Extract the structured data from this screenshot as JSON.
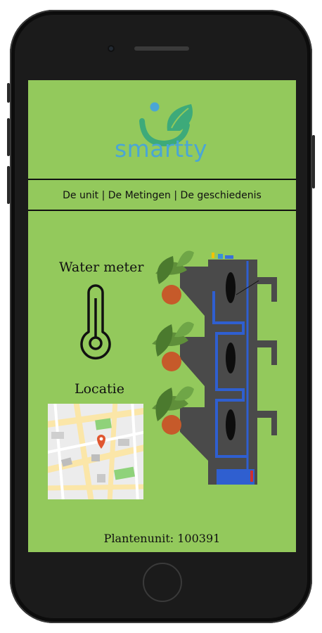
{
  "brand": {
    "name": "smartty",
    "color": "#4aa6d5",
    "leaf_color": "#3daa7a"
  },
  "nav": {
    "unit": "De unit",
    "separator": " | ",
    "measurements": "De Metingen",
    "history": "De geschiedenis"
  },
  "water_meter": {
    "title": "Water meter",
    "icon": "thermometer-icon"
  },
  "location": {
    "title": "Locatie",
    "icon": "map-pin-icon"
  },
  "plant_unit": {
    "label": "Plantenunit:",
    "value": "100391"
  },
  "colors": {
    "screen_background": "#93c95c",
    "tower": "#4a4a4a",
    "pipes": "#2f5fd0",
    "map_pin": "#e0562f"
  }
}
